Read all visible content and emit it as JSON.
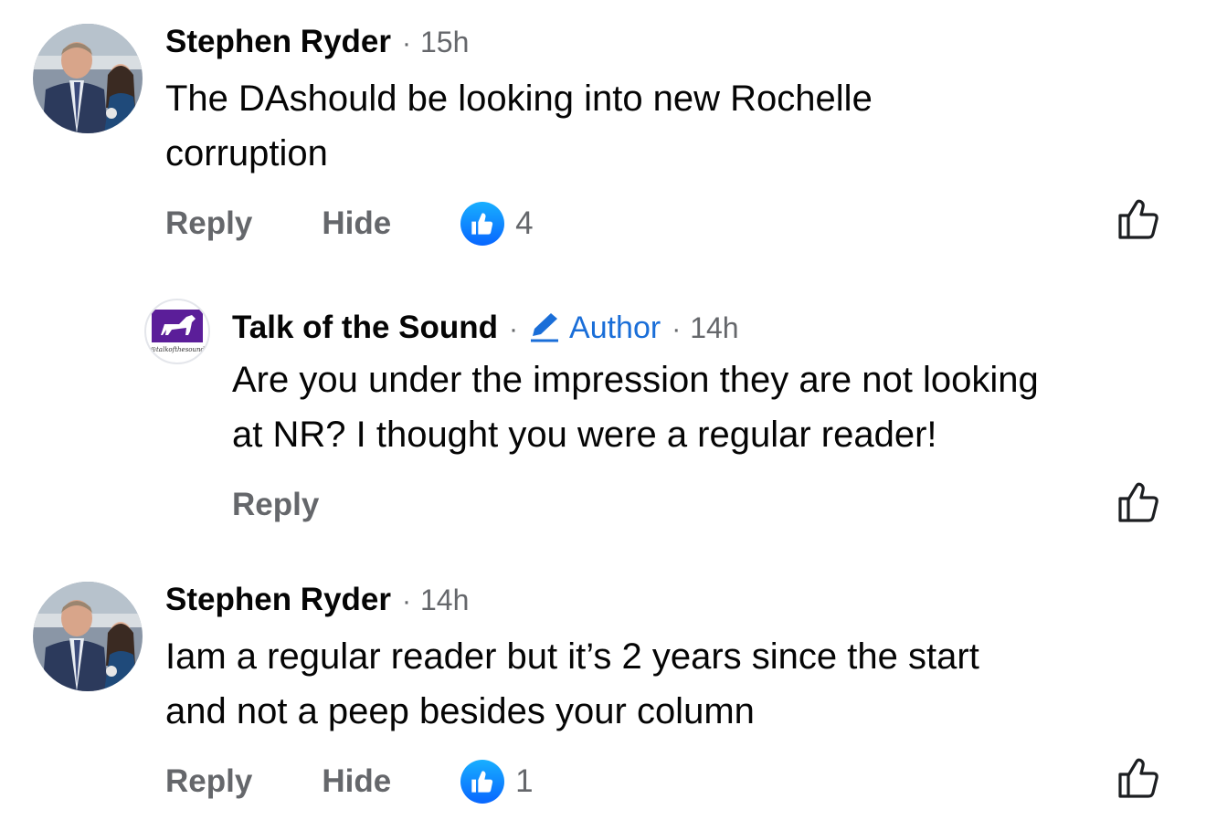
{
  "comments": [
    {
      "author": "Stephen Ryder",
      "separator": "·",
      "time": "15h",
      "text_lines": [
        "The DAshould be looking into new Rochelle",
        "corruption"
      ],
      "reply_label": "Reply",
      "hide_label": "Hide",
      "reaction_count": "4",
      "avatar_icon": "profile-photo-man-and-girl"
    },
    {
      "author": "Talk of the Sound",
      "separator": "·",
      "author_badge": "Author",
      "separator2": "·",
      "time": "14h",
      "text_lines": [
        "Are you under the impression they are not looking",
        "at NR? I thought you were a regular reader!"
      ],
      "reply_label": "Reply",
      "avatar_icon": "talk-of-the-sound-logo",
      "avatar_caption": "@talkofthesound"
    },
    {
      "author": "Stephen Ryder",
      "separator": "·",
      "time": "14h",
      "text_lines": [
        "Iam a regular reader but it’s 2 years since the start",
        "and not a peep besides your column"
      ],
      "reply_label": "Reply",
      "hide_label": "Hide",
      "reaction_count": "1",
      "avatar_icon": "profile-photo-man-and-girl"
    }
  ],
  "colors": {
    "text": "#050505",
    "secondary": "#65676b",
    "author_badge": "#1a6ed8",
    "like_blue": "#0866ff",
    "logo_purple": "#5b1e99"
  }
}
